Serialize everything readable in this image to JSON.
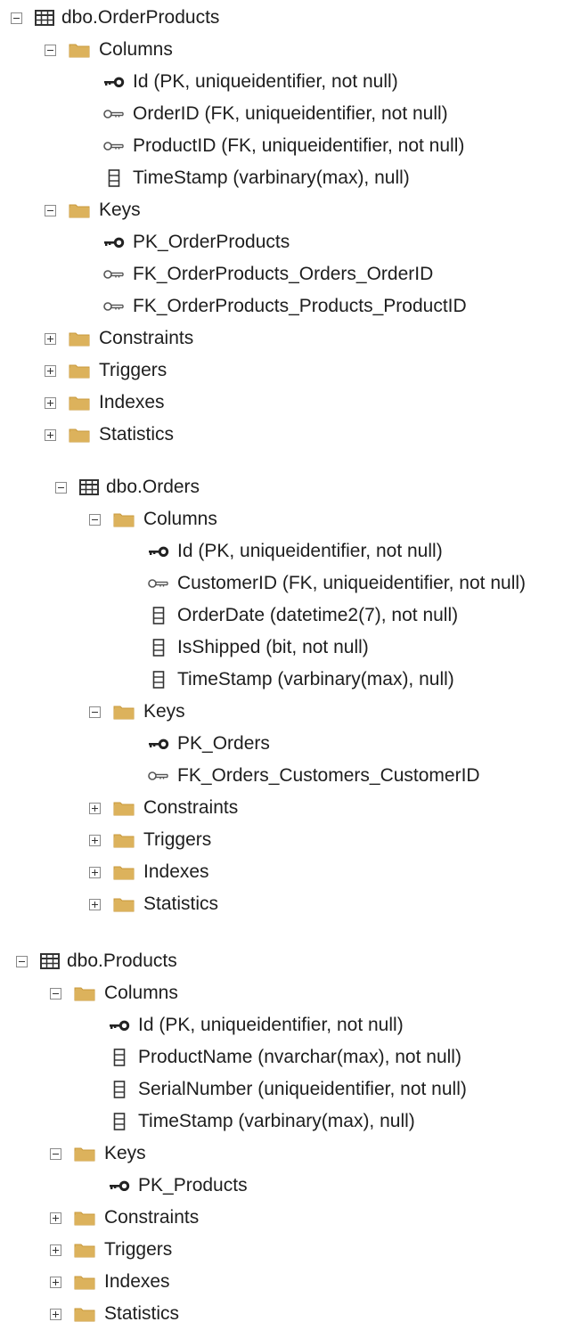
{
  "colors": {
    "folder": "#dcb25c",
    "folder_dark": "#c9993b",
    "table_grid": "#333333",
    "key_pk": "#222222",
    "key_fk": "#555555"
  },
  "tables": [
    {
      "name": "dbo.OrderProducts",
      "folders": [
        {
          "name": "Columns",
          "expanded": true,
          "items": [
            {
              "icon": "primary-key-icon",
              "text": "Id (PK, uniqueidentifier, not null)"
            },
            {
              "icon": "foreign-key-icon",
              "text": "OrderID (FK, uniqueidentifier, not null)"
            },
            {
              "icon": "foreign-key-icon",
              "text": "ProductID (FK, uniqueidentifier, not null)"
            },
            {
              "icon": "column-icon",
              "text": "TimeStamp (varbinary(max), null)"
            }
          ]
        },
        {
          "name": "Keys",
          "expanded": true,
          "items": [
            {
              "icon": "primary-key-icon",
              "text": "PK_OrderProducts"
            },
            {
              "icon": "foreign-key-icon",
              "text": "FK_OrderProducts_Orders_OrderID"
            },
            {
              "icon": "foreign-key-icon",
              "text": "FK_OrderProducts_Products_ProductID"
            }
          ]
        },
        {
          "name": "Constraints",
          "expanded": false,
          "items": []
        },
        {
          "name": "Triggers",
          "expanded": false,
          "items": []
        },
        {
          "name": "Indexes",
          "expanded": false,
          "items": []
        },
        {
          "name": "Statistics",
          "expanded": false,
          "items": []
        }
      ]
    },
    {
      "name": "dbo.Orders",
      "folders": [
        {
          "name": "Columns",
          "expanded": true,
          "items": [
            {
              "icon": "primary-key-icon",
              "text": "Id (PK, uniqueidentifier, not null)"
            },
            {
              "icon": "foreign-key-icon",
              "text": "CustomerID (FK, uniqueidentifier, not null)"
            },
            {
              "icon": "column-icon",
              "text": "OrderDate (datetime2(7), not null)"
            },
            {
              "icon": "column-icon",
              "text": "IsShipped (bit, not null)"
            },
            {
              "icon": "column-icon",
              "text": "TimeStamp (varbinary(max), null)"
            }
          ]
        },
        {
          "name": "Keys",
          "expanded": true,
          "items": [
            {
              "icon": "primary-key-icon",
              "text": "PK_Orders"
            },
            {
              "icon": "foreign-key-icon",
              "text": "FK_Orders_Customers_CustomerID"
            }
          ]
        },
        {
          "name": "Constraints",
          "expanded": false,
          "items": []
        },
        {
          "name": "Triggers",
          "expanded": false,
          "items": []
        },
        {
          "name": "Indexes",
          "expanded": false,
          "items": []
        },
        {
          "name": "Statistics",
          "expanded": false,
          "items": []
        }
      ]
    },
    {
      "name": "dbo.Products",
      "folders": [
        {
          "name": "Columns",
          "expanded": true,
          "items": [
            {
              "icon": "primary-key-icon",
              "text": "Id (PK, uniqueidentifier, not null)"
            },
            {
              "icon": "column-icon",
              "text": "ProductName (nvarchar(max), not null)"
            },
            {
              "icon": "column-icon",
              "text": "SerialNumber (uniqueidentifier, not null)"
            },
            {
              "icon": "column-icon",
              "text": "TimeStamp (varbinary(max), null)"
            }
          ]
        },
        {
          "name": "Keys",
          "expanded": true,
          "items": [
            {
              "icon": "primary-key-icon",
              "text": "PK_Products"
            }
          ]
        },
        {
          "name": "Constraints",
          "expanded": false,
          "items": []
        },
        {
          "name": "Triggers",
          "expanded": false,
          "items": []
        },
        {
          "name": "Indexes",
          "expanded": false,
          "items": []
        },
        {
          "name": "Statistics",
          "expanded": false,
          "items": []
        }
      ]
    }
  ]
}
